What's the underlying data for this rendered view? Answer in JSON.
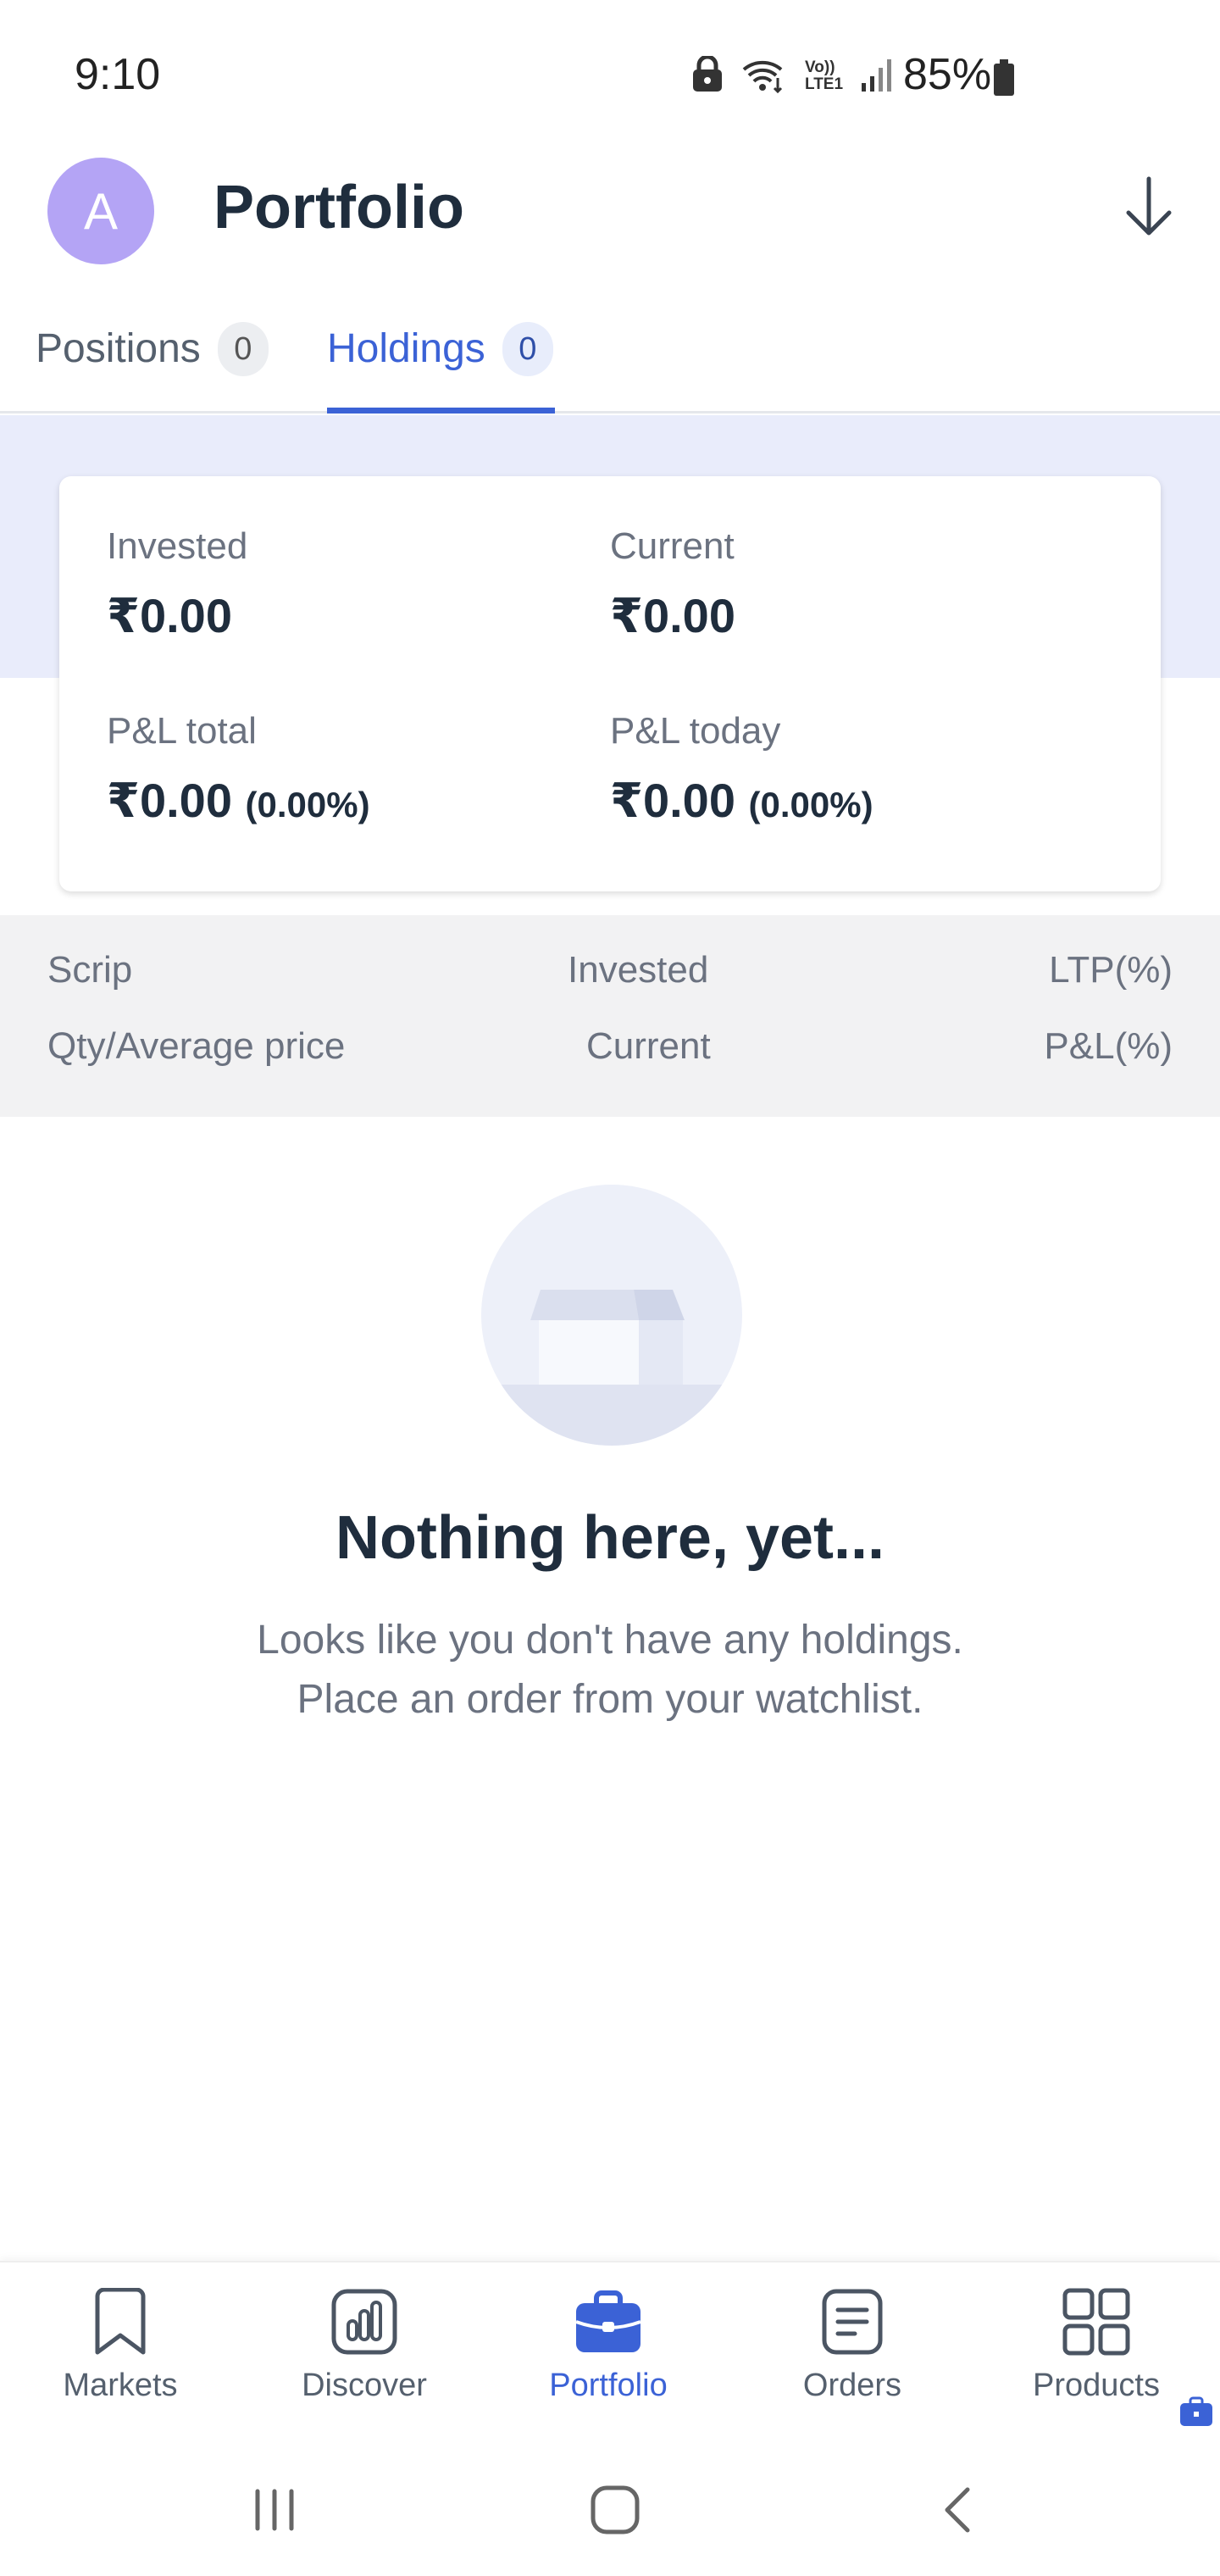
{
  "status_bar": {
    "time": "9:10",
    "battery": "85%",
    "icons": [
      "lock-icon",
      "wifi-icon",
      "volte-icon",
      "signal-icon",
      "battery-icon"
    ],
    "volte_line1": "Vo))",
    "volte_line2": "LTE1"
  },
  "header": {
    "avatar_letter": "A",
    "title": "Portfolio",
    "download_icon": "arrow-down-icon"
  },
  "tabs": [
    {
      "label": "Positions",
      "count": "0",
      "active": false
    },
    {
      "label": "Holdings",
      "count": "0",
      "active": true
    }
  ],
  "summary": {
    "invested": {
      "label": "Invested",
      "value": "₹0.00"
    },
    "current": {
      "label": "Current",
      "value": "₹0.00"
    },
    "pl_total": {
      "label": "P&L total",
      "value": "₹0.00",
      "percent": "(0.00%)"
    },
    "pl_today": {
      "label": "P&L today",
      "value": "₹0.00",
      "percent": "(0.00%)"
    }
  },
  "columns": {
    "row1": [
      "Scrip",
      "Invested",
      "LTP(%)"
    ],
    "row2": [
      "Qty/Average price",
      "Current",
      "P&L(%)"
    ]
  },
  "empty_state": {
    "icon": "empty-box-icon",
    "title": "Nothing here, yet...",
    "line1": "Looks like you don't have any holdings.",
    "line2": "Place an order from your watchlist."
  },
  "bottom_nav": [
    {
      "label": "Markets",
      "icon": "bookmark-icon",
      "active": false
    },
    {
      "label": "Discover",
      "icon": "chart-icon",
      "active": false
    },
    {
      "label": "Portfolio",
      "icon": "briefcase-icon",
      "active": true
    },
    {
      "label": "Orders",
      "icon": "document-icon",
      "active": false
    },
    {
      "label": "Products",
      "icon": "grid-icon",
      "active": false
    }
  ],
  "colors": {
    "accent": "#3b62d6",
    "avatar": "#b4a4f5",
    "summary_band": "#e9ecfb",
    "column_header": "#f2f2f3",
    "title_text": "#1f2d3d",
    "muted_text": "#6b7280"
  }
}
